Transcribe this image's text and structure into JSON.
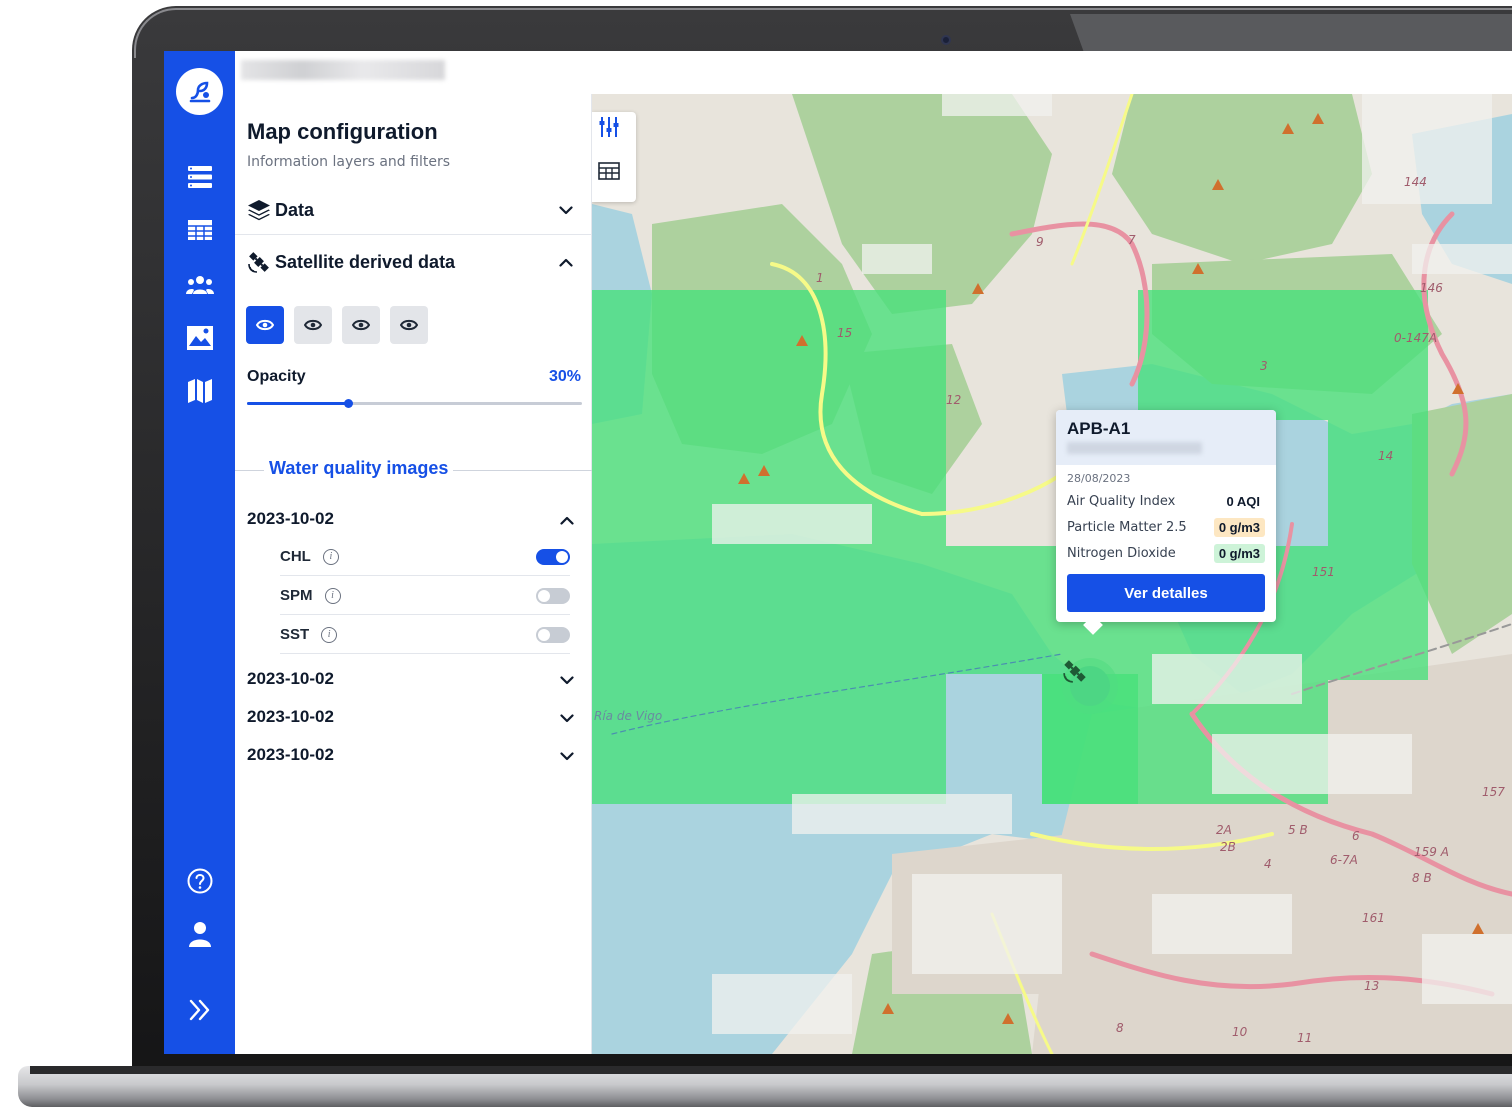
{
  "panel": {
    "title": "Map configuration",
    "subtitle": "Information layers and filters",
    "data_label": "Data",
    "satellite_label": "Satellite derived data",
    "opacity_label": "Opacity",
    "opacity_value": "30%",
    "opacity_fraction": 0.3,
    "section_title": "Water quality images",
    "dates": [
      "2023-10-02",
      "2023-10-02",
      "2023-10-02",
      "2023-10-02"
    ],
    "layers": [
      {
        "name": "CHL",
        "enabled": true
      },
      {
        "name": "SPM",
        "enabled": false
      },
      {
        "name": "SST",
        "enabled": false
      }
    ]
  },
  "popup": {
    "title": "APB-A1",
    "date": "28/08/2023",
    "rows": [
      {
        "label": "Air Quality Index",
        "value": "0 AQI",
        "color": "#ffffff"
      },
      {
        "label": "Particle Matter 2.5",
        "value": "0 g/m3",
        "color": "#fde7c2"
      },
      {
        "label": "Nitrogen Dioxide",
        "value": "0 g/m3",
        "color": "#cdf3d8"
      }
    ],
    "button_label": "Ver detalles"
  },
  "map": {
    "place_label": "Ría de Vigo",
    "road_numbers": [
      "144",
      "146",
      "0-147A",
      "14",
      "151",
      "157",
      "159 A",
      "8 B",
      "161",
      "13",
      "6-7A",
      "5 B",
      "6",
      "2A",
      "2B",
      "4",
      "8",
      "10",
      "11",
      "15",
      "12",
      "1",
      "3",
      "9",
      "7"
    ]
  },
  "icons": {
    "rail": [
      "logo-icon",
      "list-icon",
      "table-icon",
      "users-icon",
      "image-icon",
      "map-icon",
      "help-icon",
      "user-icon",
      "expand-icon"
    ],
    "tools": [
      "filter-icon",
      "table-icon"
    ]
  },
  "colors": {
    "accent": "#1650e6",
    "overlay": "#47e07a"
  }
}
